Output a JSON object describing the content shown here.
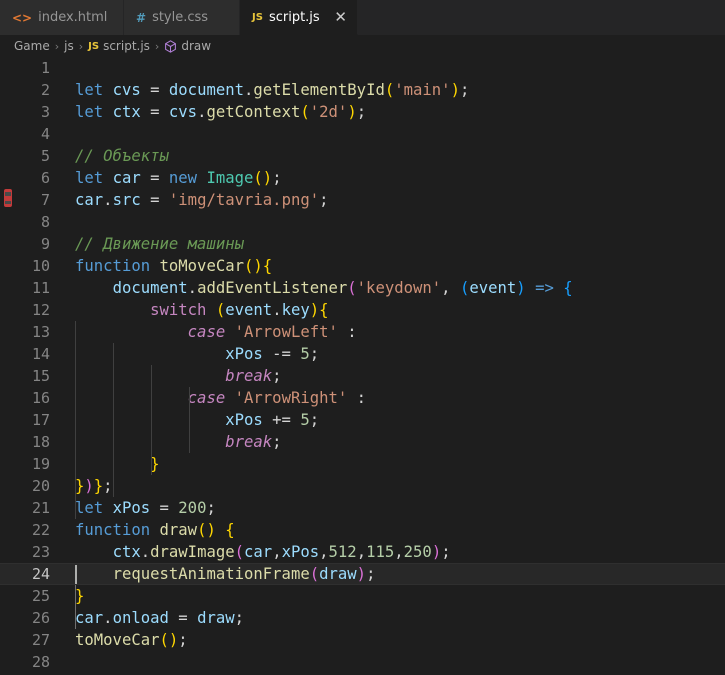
{
  "tabs": [
    {
      "label": "index.html",
      "icon": "html-icon",
      "icon_glyph": "<>",
      "active": false
    },
    {
      "label": "style.css",
      "icon": "css-icon",
      "icon_glyph": "#",
      "active": false
    },
    {
      "label": "script.js",
      "icon": "js-icon",
      "icon_glyph": "JS",
      "active": true
    }
  ],
  "close_glyph": "✕",
  "breadcrumb": {
    "items": [
      "Game",
      "js",
      "script.js",
      "draw"
    ],
    "separator": "›",
    "js_badge": "JS"
  },
  "editor": {
    "active_line": 24,
    "line_numbers": [
      "1",
      "2",
      "3",
      "4",
      "5",
      "6",
      "7",
      "8",
      "9",
      "10",
      "11",
      "12",
      "13",
      "14",
      "15",
      "16",
      "17",
      "18",
      "19",
      "20",
      "21",
      "22",
      "23",
      "24",
      "25",
      "26",
      "27",
      "28"
    ],
    "lines": [
      [],
      [
        [
          "let",
          "kw"
        ],
        [
          " ",
          "pl"
        ],
        [
          "cvs",
          "var"
        ],
        [
          " = ",
          "pl"
        ],
        [
          "document",
          "var"
        ],
        [
          ".",
          "pl"
        ],
        [
          "getElementById",
          "fn"
        ],
        [
          "(",
          "br"
        ],
        [
          "'main'",
          "str"
        ],
        [
          ")",
          "br"
        ],
        [
          ";",
          "pl"
        ]
      ],
      [
        [
          "let",
          "kw"
        ],
        [
          " ",
          "pl"
        ],
        [
          "ctx",
          "var"
        ],
        [
          " = ",
          "pl"
        ],
        [
          "cvs",
          "var"
        ],
        [
          ".",
          "pl"
        ],
        [
          "getContext",
          "fn"
        ],
        [
          "(",
          "br"
        ],
        [
          "'2d'",
          "str"
        ],
        [
          ")",
          "br"
        ],
        [
          ";",
          "pl"
        ]
      ],
      [],
      [
        [
          "// Объекты",
          "cmt"
        ]
      ],
      [
        [
          "let",
          "kw"
        ],
        [
          " ",
          "pl"
        ],
        [
          "car",
          "var"
        ],
        [
          " = ",
          "pl"
        ],
        [
          "new",
          "kw"
        ],
        [
          " ",
          "pl"
        ],
        [
          "Image",
          "cls"
        ],
        [
          "()",
          "br"
        ],
        [
          ";",
          "pl"
        ]
      ],
      [
        [
          "car",
          "var"
        ],
        [
          ".",
          "pl"
        ],
        [
          "src",
          "var"
        ],
        [
          " = ",
          "pl"
        ],
        [
          "'img/tavria.png'",
          "str"
        ],
        [
          ";",
          "pl"
        ]
      ],
      [],
      [
        [
          "// Движение машины",
          "cmt"
        ]
      ],
      [
        [
          "function",
          "kw"
        ],
        [
          " ",
          "pl"
        ],
        [
          "toMoveCar",
          "fn"
        ],
        [
          "()",
          "br"
        ],
        [
          "{",
          "br"
        ]
      ],
      [
        [
          "    ",
          "pl"
        ],
        [
          "document",
          "var"
        ],
        [
          ".",
          "pl"
        ],
        [
          "addEventListener",
          "fn"
        ],
        [
          "(",
          "br2"
        ],
        [
          "'keydown'",
          "str"
        ],
        [
          ", ",
          "pl"
        ],
        [
          "(",
          "br3"
        ],
        [
          "event",
          "var"
        ],
        [
          ")",
          "br3"
        ],
        [
          " ",
          "pl"
        ],
        [
          "=>",
          "kw"
        ],
        [
          " ",
          "pl"
        ],
        [
          "{",
          "br3"
        ]
      ],
      [
        [
          "        ",
          "pl"
        ],
        [
          "switch",
          "kw2"
        ],
        [
          " ",
          "pl"
        ],
        [
          "(",
          "br"
        ],
        [
          "event",
          "var"
        ],
        [
          ".",
          "pl"
        ],
        [
          "key",
          "var"
        ],
        [
          ")",
          "br"
        ],
        [
          "{",
          "br"
        ]
      ],
      [
        [
          "            ",
          "pl"
        ],
        [
          "case",
          "kw2 itl"
        ],
        [
          " ",
          "pl"
        ],
        [
          "'ArrowLeft'",
          "str"
        ],
        [
          " :",
          "pl"
        ]
      ],
      [
        [
          "                ",
          "pl"
        ],
        [
          "xPos",
          "var"
        ],
        [
          " -= ",
          "pl"
        ],
        [
          "5",
          "num"
        ],
        [
          ";",
          "pl"
        ]
      ],
      [
        [
          "                ",
          "pl"
        ],
        [
          "break",
          "kw2 itl"
        ],
        [
          ";",
          "pl"
        ]
      ],
      [
        [
          "            ",
          "pl"
        ],
        [
          "case",
          "kw2 itl"
        ],
        [
          " ",
          "pl"
        ],
        [
          "'ArrowRight'",
          "str"
        ],
        [
          " :",
          "pl"
        ]
      ],
      [
        [
          "                ",
          "pl"
        ],
        [
          "xPos",
          "var"
        ],
        [
          " += ",
          "pl"
        ],
        [
          "5",
          "num"
        ],
        [
          ";",
          "pl"
        ]
      ],
      [
        [
          "                ",
          "pl"
        ],
        [
          "break",
          "kw2 itl"
        ],
        [
          ";",
          "pl"
        ]
      ],
      [
        [
          "        ",
          "pl"
        ],
        [
          "}",
          "br"
        ]
      ],
      [
        [
          "}",
          "br"
        ],
        [
          ")",
          "br2"
        ],
        [
          "}",
          "br"
        ],
        [
          ";",
          "pl"
        ]
      ],
      [
        [
          "let",
          "kw"
        ],
        [
          " ",
          "pl"
        ],
        [
          "xPos",
          "var"
        ],
        [
          " = ",
          "pl"
        ],
        [
          "200",
          "num"
        ],
        [
          ";",
          "pl"
        ]
      ],
      [
        [
          "function",
          "kw"
        ],
        [
          " ",
          "pl"
        ],
        [
          "draw",
          "fn"
        ],
        [
          "()",
          "br"
        ],
        [
          " ",
          "pl"
        ],
        [
          "{",
          "br"
        ]
      ],
      [
        [
          "    ",
          "pl"
        ],
        [
          "ctx",
          "var"
        ],
        [
          ".",
          "pl"
        ],
        [
          "drawImage",
          "fn"
        ],
        [
          "(",
          "br2"
        ],
        [
          "car",
          "var"
        ],
        [
          ",",
          "pl"
        ],
        [
          "xPos",
          "var"
        ],
        [
          ",",
          "pl"
        ],
        [
          "512",
          "num"
        ],
        [
          ",",
          "pl"
        ],
        [
          "115",
          "num"
        ],
        [
          ",",
          "pl"
        ],
        [
          "250",
          "num"
        ],
        [
          ")",
          "br2"
        ],
        [
          ";",
          "pl"
        ]
      ],
      [
        [
          "    ",
          "pl"
        ],
        [
          "requestAnimationFrame",
          "fn"
        ],
        [
          "(",
          "br2"
        ],
        [
          "draw",
          "var"
        ],
        [
          ")",
          "br2"
        ],
        [
          ";",
          "pl"
        ]
      ],
      [
        [
          "}",
          "br"
        ]
      ],
      [
        [
          "car",
          "var"
        ],
        [
          ".",
          "pl"
        ],
        [
          "onload",
          "var"
        ],
        [
          " = ",
          "pl"
        ],
        [
          "draw",
          "var"
        ],
        [
          ";",
          "pl"
        ]
      ],
      [
        [
          "toMoveCar",
          "fn"
        ],
        [
          "()",
          "br"
        ],
        [
          ";",
          "pl"
        ]
      ],
      []
    ]
  },
  "colors": {
    "keyword": "#569cd6",
    "control": "#c586c0",
    "variable": "#9cdcfe",
    "function": "#dcdcaa",
    "string": "#ce9178",
    "number": "#b5cea8",
    "comment": "#6a9955",
    "class": "#4ec9b0",
    "bracket1": "#ffd700"
  }
}
